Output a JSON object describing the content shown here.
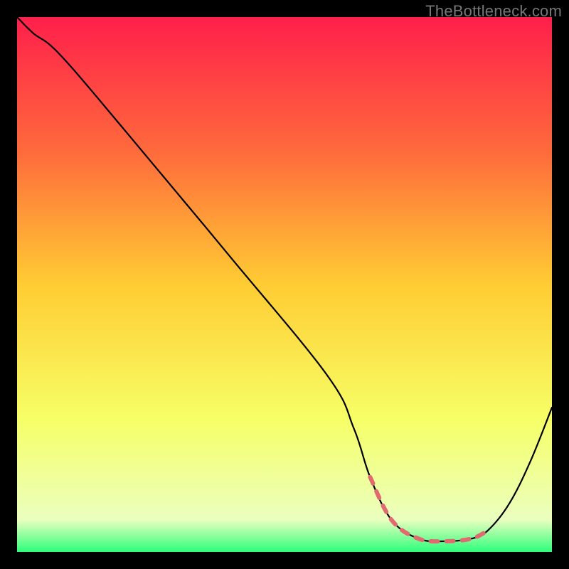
{
  "watermark": "TheBottleneck.com",
  "chart_data": {
    "type": "line",
    "title": "",
    "xlabel": "",
    "ylabel": "",
    "xlim": [
      0,
      100
    ],
    "ylim": [
      0,
      100
    ],
    "grid": false,
    "legend": false,
    "gradient_stops": [
      {
        "offset": 0,
        "color": "#ff1f4b"
      },
      {
        "offset": 0.25,
        "color": "#ff6a3c"
      },
      {
        "offset": 0.5,
        "color": "#ffcc33"
      },
      {
        "offset": 0.75,
        "color": "#f7ff66"
      },
      {
        "offset": 0.94,
        "color": "#eaffbf"
      },
      {
        "offset": 1.0,
        "color": "#2bff7a"
      }
    ],
    "series": [
      {
        "name": "bottleneck-curve",
        "color": "#000000",
        "x": [
          0,
          3,
          8,
          20,
          40,
          58,
          63,
          66,
          70,
          75,
          80,
          85,
          88,
          92,
          96,
          100
        ],
        "y": [
          100,
          97,
          93,
          79,
          55,
          33,
          23,
          14,
          6,
          2.5,
          2,
          2.5,
          4,
          9,
          17,
          27
        ]
      }
    ],
    "dashed_segment": {
      "from_index": 7,
      "to_index": 12,
      "color": "#e06a6f",
      "width": 6,
      "dash": "10 12"
    }
  }
}
